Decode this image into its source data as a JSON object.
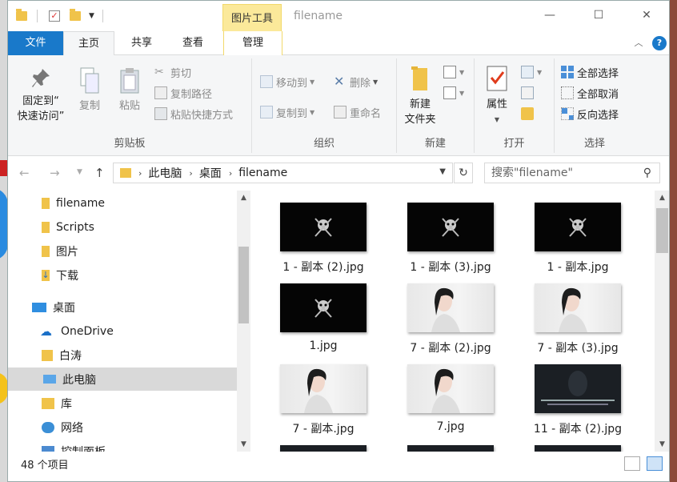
{
  "window": {
    "title": "filename",
    "tool_tab": "图片工具",
    "controls": {
      "minimize": "—",
      "maximize": "☐",
      "close": "✕"
    }
  },
  "tabs": {
    "file": "文件",
    "home": "主页",
    "share": "共享",
    "view": "查看",
    "manage": "管理",
    "help": "?"
  },
  "ribbon": {
    "clipboard": {
      "group": "剪贴板",
      "pin_line1": "固定到“",
      "pin_line2": "快速访问”",
      "copy": "复制",
      "paste": "粘贴",
      "cut": "剪切",
      "copy_path": "复制路径",
      "paste_shortcut": "粘贴快捷方式"
    },
    "organize": {
      "group": "组织",
      "move_to": "移动到",
      "copy_to": "复制到",
      "delete": "删除",
      "rename": "重命名"
    },
    "new": {
      "group": "新建",
      "new_folder_line1": "新建",
      "new_folder_line2": "文件夹"
    },
    "open": {
      "group": "打开",
      "properties": "属性"
    },
    "select": {
      "group": "选择",
      "select_all": "全部选择",
      "select_none": "全部取消",
      "invert": "反向选择"
    },
    "colors": {
      "file_tab": "#1979ca",
      "tool_tab": "#fbe99a",
      "folder": "#f0c34a"
    }
  },
  "nav": {
    "breadcrumb": [
      "此电脑",
      "桌面",
      "filename"
    ],
    "search_placeholder": "搜索\"filename\""
  },
  "sidebar": {
    "items": [
      {
        "label": "filename",
        "icon": "folder-icon"
      },
      {
        "label": "Scripts",
        "icon": "folder-icon"
      },
      {
        "label": "图片",
        "icon": "folder-icon"
      },
      {
        "label": "下载",
        "icon": "download-icon"
      },
      {
        "label": "桌面",
        "icon": "desktop-icon"
      },
      {
        "label": "OneDrive",
        "icon": "cloud-icon"
      },
      {
        "label": "白涛",
        "icon": "user-folder-icon"
      },
      {
        "label": "此电脑",
        "icon": "computer-icon",
        "selected": true
      },
      {
        "label": "库",
        "icon": "library-icon"
      },
      {
        "label": "网络",
        "icon": "network-icon"
      },
      {
        "label": "控制面板",
        "icon": "control-panel-icon"
      }
    ]
  },
  "files": [
    {
      "name": "1 - 副本 (2).jpg",
      "kind": "dark"
    },
    {
      "name": "1 - 副本 (3).jpg",
      "kind": "dark"
    },
    {
      "name": "1 - 副本.jpg",
      "kind": "dark"
    },
    {
      "name": "1.jpg",
      "kind": "dark"
    },
    {
      "name": "7 - 副本 (2).jpg",
      "kind": "photo"
    },
    {
      "name": "7 - 副本 (3).jpg",
      "kind": "photo"
    },
    {
      "name": "7 - 副本.jpg",
      "kind": "photo"
    },
    {
      "name": "7.jpg",
      "kind": "photo"
    },
    {
      "name": "11 - 副本 (2).jpg",
      "kind": "scene"
    }
  ],
  "status": {
    "item_count": "48 个项目"
  }
}
